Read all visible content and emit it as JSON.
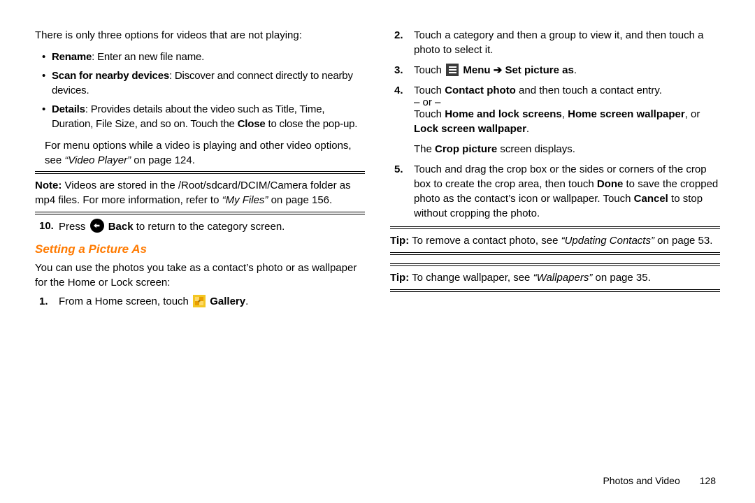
{
  "leftCol": {
    "intro": "There is only three options for videos that are not playing:",
    "bullets": [
      {
        "lead": "Rename",
        "rest": ": Enter an new file name."
      },
      {
        "lead": "Scan for nearby devices",
        "rest": ": Discover and connect directly to nearby devices."
      },
      {
        "lead": "Details",
        "rest": ": Provides details about the video such as Title, Time, Duration, File Size, and so on. Touch the ",
        "bold": "Close",
        "rest2": " to close the pop-up."
      }
    ],
    "afterBullets1": "For menu options while a video is playing and other video options, see ",
    "afterBulletsItalic": "“Video Player”",
    "afterBullets2": " on page 124.",
    "noteLead": "Note:",
    "noteText1": " Videos are stored in the /Root/sdcard/DCIM/Camera folder as mp4 files. For more information, refer to ",
    "noteItalic": "“My Files”",
    "noteText2": " on page 156.",
    "step10num": "10.",
    "step10a": "Press ",
    "step10bold": " Back",
    "step10b": " to return to the category screen.",
    "sectTitle": "Setting a Picture As",
    "sectIntro": "You can use the photos you take as a contact’s photo or as wallpaper for the Home or Lock screen:",
    "step1num": "1.",
    "step1a": "From a Home screen, touch ",
    "step1bold": " Gallery",
    "step1b": "."
  },
  "rightCol": {
    "step2num": "2.",
    "step2": "Touch a category and then a group to view it, and then touch a photo to select it.",
    "step3num": "3.",
    "step3a": "Touch ",
    "step3bold1": " Menu ",
    "arrow": "➔",
    "step3bold2": " Set picture as",
    "step3b": ".",
    "step4num": "4.",
    "step4a": "Touch ",
    "step4bold1": "Contact photo",
    "step4b": " and then touch a contact entry.",
    "or": "– or –",
    "step4c": "Touch ",
    "step4bold2": "Home and lock screens",
    "step4d": ", ",
    "step4bold3": "Home screen wallpaper",
    "step4e": ", or ",
    "step4bold4": "Lock screen wallpaper",
    "step4f": ".",
    "crop1": "The ",
    "cropBold": "Crop picture",
    "crop2": " screen displays.",
    "step5num": "5.",
    "step5a": "Touch and drag the crop box or the sides or corners of the crop box to create the crop area, then touch ",
    "step5bold1": "Done",
    "step5b": " to save the cropped photo as the contact’s icon or wallpaper. Touch ",
    "step5bold2": "Cancel",
    "step5c": " to stop without cropping the photo.",
    "tip1Lead": "Tip:",
    "tip1a": " To remove a contact photo, see ",
    "tip1Italic": "“Updating Contacts”",
    "tip1b": " on page 53.",
    "tip2Lead": "Tip:",
    "tip2a": " To change wallpaper, see ",
    "tip2Italic": "“Wallpapers”",
    "tip2b": " on page 35."
  },
  "footer": {
    "section": "Photos and Video",
    "page": "128"
  }
}
